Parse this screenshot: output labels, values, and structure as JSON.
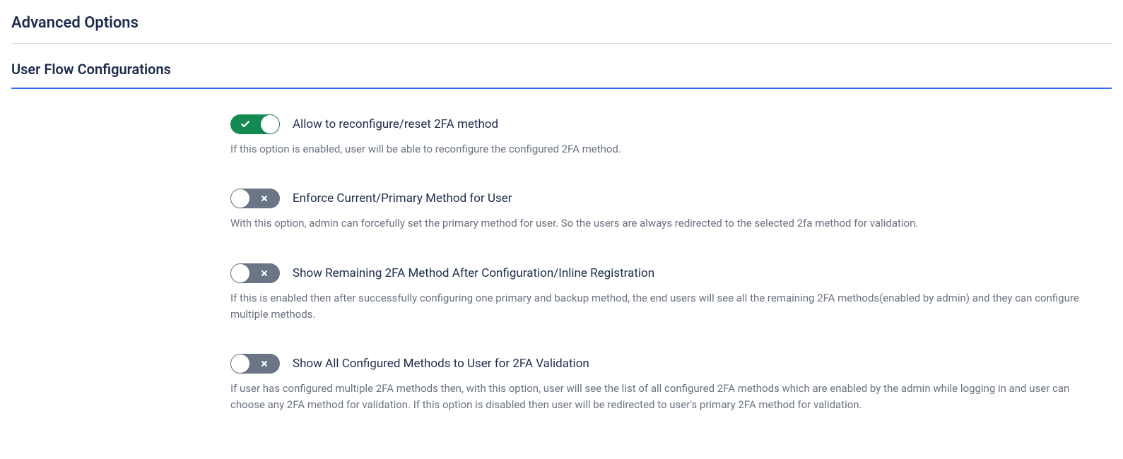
{
  "section_title": "Advanced Options",
  "subsection_title": "User Flow Configurations",
  "options": [
    {
      "enabled": true,
      "label": "Allow to reconfigure/reset 2FA method",
      "description": "If this option is enabled, user will be able to reconfigure the configured 2FA method."
    },
    {
      "enabled": false,
      "label": "Enforce Current/Primary Method for User",
      "description": "With this option, admin can forcefully set the primary method for user. So the users are always redirected to the selected 2fa method for validation."
    },
    {
      "enabled": false,
      "label": "Show Remaining 2FA Method After Configuration/Inline Registration",
      "description": "If this is enabled then after successfully configuring one primary and backup method, the end users will see all the remaining 2FA methods(enabled by admin) and they can configure multiple methods."
    },
    {
      "enabled": false,
      "label": "Show All Configured Methods to User for 2FA Validation",
      "description": "If user has configured multiple 2FA methods then, with this option, user will see the list of all configured 2FA methods which are enabled by the admin while logging in and user can choose any 2FA method for validation. If this option is disabled then user will be redirected to user's primary 2FA method for validation."
    }
  ]
}
